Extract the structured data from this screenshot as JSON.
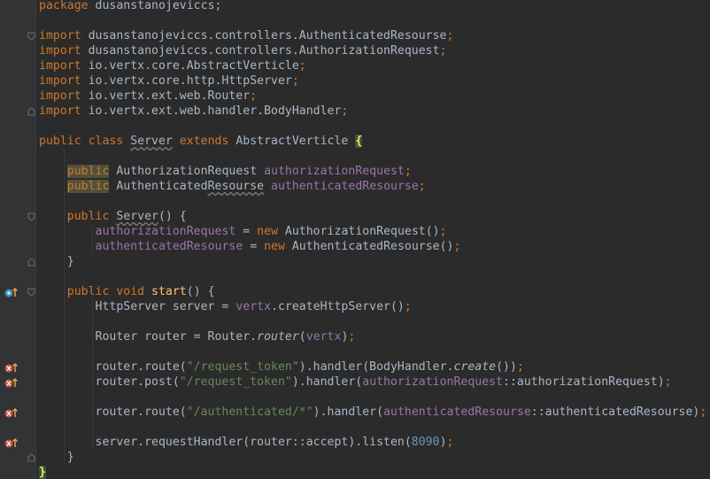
{
  "code": {
    "lines": [
      [
        {
          "t": "package ",
          "c": "kw"
        },
        {
          "t": "dusanstanojeviccs;",
          "c": ""
        }
      ],
      [],
      [
        {
          "t": "import ",
          "c": "kw"
        },
        {
          "t": "dusanstanojeviccs.controllers.AuthenticatedResourse",
          "c": ""
        },
        {
          "t": ";",
          "c": "kw"
        }
      ],
      [
        {
          "t": "import ",
          "c": "kw"
        },
        {
          "t": "dusanstanojeviccs.controllers.AuthorizationRequest",
          "c": ""
        },
        {
          "t": ";",
          "c": "kw"
        }
      ],
      [
        {
          "t": "import ",
          "c": "kw"
        },
        {
          "t": "io.vertx.core.AbstractVerticle",
          "c": ""
        },
        {
          "t": ";",
          "c": "kw"
        }
      ],
      [
        {
          "t": "import ",
          "c": "kw"
        },
        {
          "t": "io.vertx.core.http.HttpServer",
          "c": ""
        },
        {
          "t": ";",
          "c": "kw"
        }
      ],
      [
        {
          "t": "import ",
          "c": "kw"
        },
        {
          "t": "io.vertx.ext.web.Router",
          "c": ""
        },
        {
          "t": ";",
          "c": "kw"
        }
      ],
      [
        {
          "t": "import ",
          "c": "kw"
        },
        {
          "t": "io.vertx.ext.web.handler.BodyHandler",
          "c": ""
        },
        {
          "t": ";",
          "c": "kw"
        }
      ],
      [],
      [
        {
          "t": "public class ",
          "c": "kw"
        },
        {
          "t": "Server",
          "c": "warn-under"
        },
        {
          "t": " ",
          "c": ""
        },
        {
          "t": "extends ",
          "c": "kw"
        },
        {
          "t": "AbstractVerticle ",
          "c": ""
        },
        {
          "t": "{",
          "c": "brace-hl"
        }
      ],
      [],
      [
        {
          "t": "    ",
          "c": ""
        },
        {
          "t": "public",
          "c": "kw pub-hl"
        },
        {
          "t": " AuthorizationRequest ",
          "c": ""
        },
        {
          "t": "authorizationRequest",
          "c": "field"
        },
        {
          "t": ";",
          "c": "kw"
        }
      ],
      [
        {
          "t": "    ",
          "c": ""
        },
        {
          "t": "public",
          "c": "kw pub-hl"
        },
        {
          "t": " Authenticated",
          "c": ""
        },
        {
          "t": "Resourse",
          "c": "warn-under"
        },
        {
          "t": " ",
          "c": ""
        },
        {
          "t": "authenticatedResourse",
          "c": "field"
        },
        {
          "t": ";",
          "c": "kw"
        }
      ],
      [],
      [
        {
          "t": "    ",
          "c": ""
        },
        {
          "t": "public ",
          "c": "kw"
        },
        {
          "t": "Server",
          "c": "warn-under"
        },
        {
          "t": "() {",
          "c": ""
        }
      ],
      [
        {
          "t": "        ",
          "c": ""
        },
        {
          "t": "authorizationRequest",
          "c": "field"
        },
        {
          "t": " = ",
          "c": ""
        },
        {
          "t": "new ",
          "c": "kw"
        },
        {
          "t": "AuthorizationRequest()",
          "c": ""
        },
        {
          "t": ";",
          "c": "kw"
        }
      ],
      [
        {
          "t": "        ",
          "c": ""
        },
        {
          "t": "authenticatedResourse",
          "c": "field"
        },
        {
          "t": " = ",
          "c": ""
        },
        {
          "t": "new ",
          "c": "kw"
        },
        {
          "t": "AuthenticatedResourse()",
          "c": ""
        },
        {
          "t": ";",
          "c": "kw"
        }
      ],
      [
        {
          "t": "    }",
          "c": ""
        }
      ],
      [],
      [
        {
          "t": "    ",
          "c": ""
        },
        {
          "t": "public void ",
          "c": "kw"
        },
        {
          "t": "start",
          "c": "fn"
        },
        {
          "t": "() {",
          "c": ""
        }
      ],
      [
        {
          "t": "        HttpServer server = ",
          "c": ""
        },
        {
          "t": "vertx",
          "c": "field"
        },
        {
          "t": ".createHttpServer()",
          "c": ""
        },
        {
          "t": ";",
          "c": "kw"
        }
      ],
      [],
      [
        {
          "t": "        Router router = Router.",
          "c": ""
        },
        {
          "t": "router",
          "c": "ital"
        },
        {
          "t": "(",
          "c": ""
        },
        {
          "t": "vertx",
          "c": "field"
        },
        {
          "t": ")",
          "c": ""
        },
        {
          "t": ";",
          "c": "kw"
        }
      ],
      [],
      [
        {
          "t": "        router.route(",
          "c": ""
        },
        {
          "t": "\"/request_token\"",
          "c": "str"
        },
        {
          "t": ").handler(BodyHandler.",
          "c": ""
        },
        {
          "t": "create",
          "c": "ital"
        },
        {
          "t": "())",
          "c": ""
        },
        {
          "t": ";",
          "c": "kw"
        }
      ],
      [
        {
          "t": "        router.post(",
          "c": ""
        },
        {
          "t": "\"/request_token\"",
          "c": "str"
        },
        {
          "t": ").handler(",
          "c": ""
        },
        {
          "t": "authorizationRequest",
          "c": "field"
        },
        {
          "t": "::authorizationRequest)",
          "c": ""
        },
        {
          "t": ";",
          "c": "kw"
        }
      ],
      [],
      [
        {
          "t": "        router.route(",
          "c": ""
        },
        {
          "t": "\"/authenticated/*\"",
          "c": "str"
        },
        {
          "t": ").handler(",
          "c": ""
        },
        {
          "t": "authenticatedResourse",
          "c": "field"
        },
        {
          "t": "::authenticatedResourse)",
          "c": ""
        },
        {
          "t": ";",
          "c": "kw"
        }
      ],
      [],
      [
        {
          "t": "        server.requestHandler(router::accept).listen(",
          "c": ""
        },
        {
          "t": "8090",
          "c": "num"
        },
        {
          "t": ")",
          "c": ""
        },
        {
          "t": ";",
          "c": "kw"
        }
      ],
      [
        {
          "t": "    }",
          "c": ""
        }
      ],
      [
        {
          "t": "}",
          "c": "brace-hl"
        }
      ]
    ]
  },
  "gutter": {
    "fold_lines": [
      2,
      7,
      14,
      17,
      19,
      30
    ],
    "override_icon_line": 19,
    "lambda_icon_lines": [
      24,
      25,
      27,
      29
    ]
  },
  "colors": {
    "background": "#2b2b2b",
    "gutter": "#313335",
    "keyword": "#cc7832",
    "field": "#9876aa",
    "string": "#6a8759",
    "number": "#6897bb",
    "method_decl": "#ffc66d",
    "default_text": "#a9b7c6",
    "gutter_icon_red": "#c75450",
    "gutter_icon_blue": "#3592c4",
    "gutter_arrow": "#e8a33e"
  },
  "icons": {
    "fold": "fold-arrow-icon",
    "override": "override-method-icon",
    "lambda": "lambda-recursive-icon"
  }
}
